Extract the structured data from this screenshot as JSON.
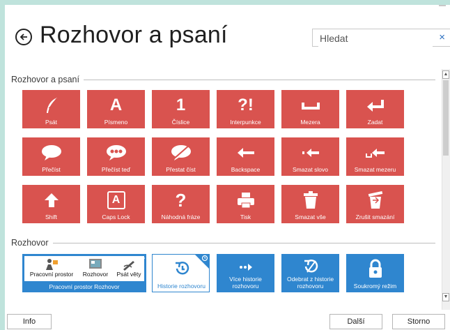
{
  "header": {
    "title": "Rozhovor a psaní",
    "search_placeholder": "Hledat",
    "clear_symbol": "×"
  },
  "sections": {
    "writing": "Rozhovor a psaní",
    "conversation": "Rozhovor"
  },
  "tiles": [
    {
      "label": "Psát",
      "icon": "quill-icon",
      "glyph": ""
    },
    {
      "label": "Písmeno",
      "icon": "letter-a-icon",
      "glyph": "A"
    },
    {
      "label": "Číslice",
      "icon": "digit-icon",
      "glyph": "1"
    },
    {
      "label": "Interpunkce",
      "icon": "punctuation-icon",
      "glyph": "?!"
    },
    {
      "label": "Mezera",
      "icon": "space-icon",
      "glyph": ""
    },
    {
      "label": "Zadat",
      "icon": "enter-icon",
      "glyph": ""
    },
    {
      "label": "Přečíst",
      "icon": "speech-bubble-icon",
      "glyph": ""
    },
    {
      "label": "Přečíst teď",
      "icon": "speech-bubble-dots-icon",
      "glyph": ""
    },
    {
      "label": "Přestat číst",
      "icon": "speech-bubble-stop-icon",
      "glyph": ""
    },
    {
      "label": "Backspace",
      "icon": "backspace-icon",
      "glyph": ""
    },
    {
      "label": "Smazat slovo",
      "icon": "delete-word-icon",
      "glyph": ""
    },
    {
      "label": "Smazat mezeru",
      "icon": "delete-space-icon",
      "glyph": ""
    },
    {
      "label": "Shift",
      "icon": "shift-icon",
      "glyph": ""
    },
    {
      "label": "Caps Lock",
      "icon": "caps-lock-icon",
      "glyph": "A"
    },
    {
      "label": "Náhodná fráze",
      "icon": "question-icon",
      "glyph": "?"
    },
    {
      "label": "Tisk",
      "icon": "printer-icon",
      "glyph": ""
    },
    {
      "label": "Smazat vše",
      "icon": "trash-icon",
      "glyph": ""
    },
    {
      "label": "Zrušit smazání",
      "icon": "undo-delete-icon",
      "glyph": ""
    }
  ],
  "workspace": {
    "label": "Pracovní prostor Rozhovor",
    "items": [
      "Pracovní prostor",
      "Rozhovor",
      "Psát věty"
    ]
  },
  "blue_tiles": [
    {
      "label": "Historie rozhovoru",
      "icon": "history-icon"
    },
    {
      "label": "Více historie rozhovoru",
      "icon": "more-history-icon"
    },
    {
      "label": "Odebrat z historie rozhovoru",
      "icon": "remove-history-icon"
    },
    {
      "label": "Soukromý režim",
      "icon": "lock-icon"
    }
  ],
  "footer": {
    "info": "Info",
    "next": "Další",
    "cancel": "Storno"
  },
  "colors": {
    "tile_red": "#d9534f",
    "tile_blue": "#2f86cf",
    "background": "#bfe3dc"
  }
}
